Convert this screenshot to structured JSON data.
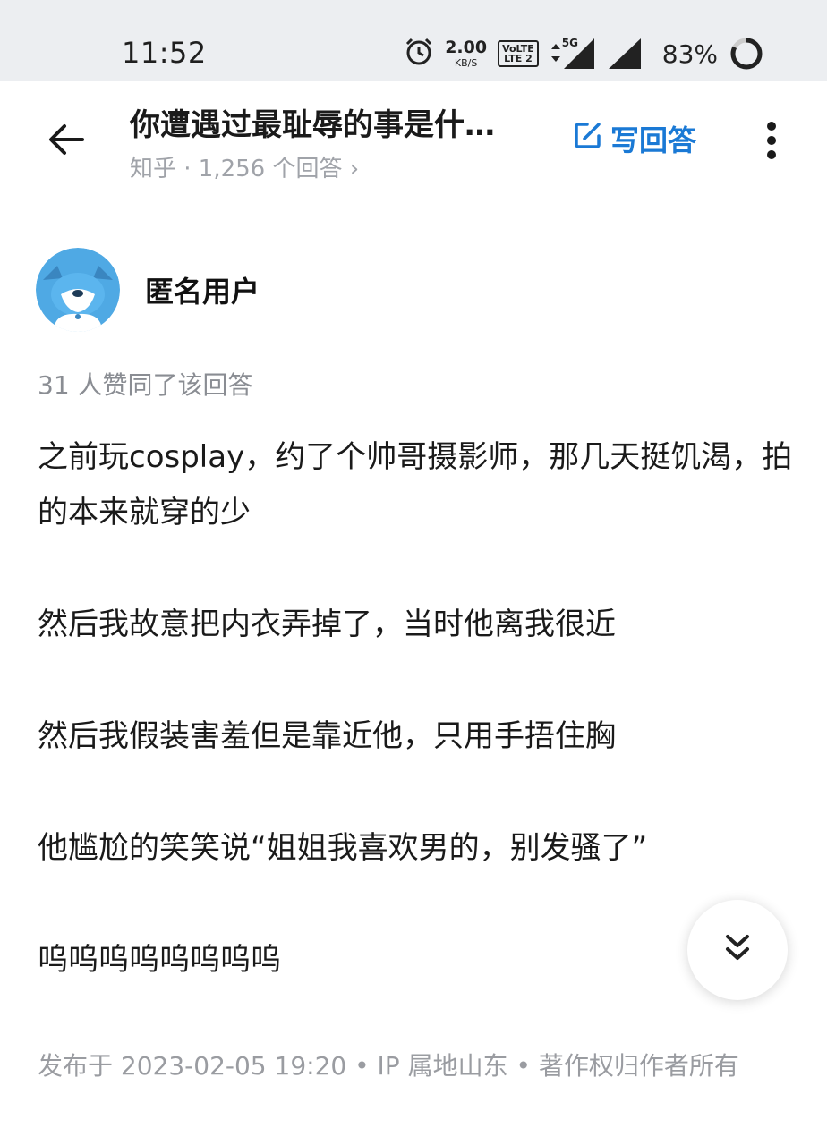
{
  "status_bar": {
    "time": "11:52",
    "net_speed_value": "2.00",
    "net_speed_unit": "KB/S",
    "volte_line1": "VoLTE",
    "volte_line2": "LTE 2",
    "network_type": "5G",
    "battery": "83%"
  },
  "header": {
    "question_title": "你遭遇过最耻辱的事是什…",
    "meta": "知乎 · 1,256 个回答 ›",
    "write_answer_label": "写回答"
  },
  "author": {
    "name": "匿名用户"
  },
  "answer": {
    "votes_text": "31 人赞同了该回答",
    "paragraphs": [
      "之前玩cosplay，约了个帅哥摄影师，那几天挺饥渴，拍的本来就穿的少",
      "然后我故意把内衣弄掉了，当时他离我很近",
      "然后我假装害羞但是靠近他，只用手捂住胸",
      "他尴尬的笑笑说“姐姐我喜欢男的，别发骚了”",
      "呜呜呜呜呜呜呜呜"
    ],
    "footer": "发布于 2023-02-05 19:20 • IP 属地山东 • 著作权归作者所有"
  },
  "colors": {
    "accent": "#1a79d5",
    "status_bg": "#eceef1",
    "muted_text": "#9a9ca1"
  },
  "icons": [
    "alarm-icon",
    "signal-icon",
    "battery-ring-icon",
    "back-arrow-icon",
    "edit-icon",
    "more-icon",
    "double-chevron-down-icon"
  ]
}
